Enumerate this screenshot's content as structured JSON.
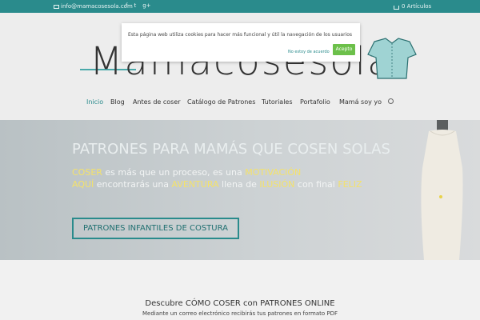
{
  "topbar": {
    "email": "info@mamacosesola.com",
    "social": [
      "f",
      "t",
      "g+"
    ],
    "cart_label": "0 Artículos"
  },
  "logo": {
    "text": "Mamacosesola"
  },
  "nav": {
    "items": [
      "Inicio",
      "Blog",
      "Antes de coser",
      "Catálogo de Patrones",
      "Tutoriales",
      "Portafolio",
      "Mamá soy yo"
    ]
  },
  "cookie": {
    "message": "Esta página web utiliza cookies para hacer más funcional y útil la navegación de los usuarios",
    "decline": "No estoy de acuerdo",
    "accept": "Acepto"
  },
  "hero": {
    "heading": "PATRONES PARA MAMÁS QUE COSEN SOLAS",
    "line1_a": "COSER",
    "line1_b": " es más que un proceso, es una ",
    "line1_c": "MOTIVACIÓN",
    "line2_a": "AQUÍ",
    "line2_b": " encontrarás una ",
    "line2_c": "AVENTURA",
    "line2_d": " llena de ",
    "line2_e": "ILUSIÓN",
    "line2_f": " con final ",
    "line2_g": "FELIZ",
    "cta": "PATRONES INFANTILES DE COSTURA"
  },
  "section": {
    "title": "Descubre CÓMO COSER con PATRONES ONLINE",
    "subtitle": "Mediante un correo electrónico recibirás tus patrones en formato PDF"
  },
  "colors": {
    "accent": "#2a8b8c",
    "accept": "#6cc04a",
    "highlight": "#f4e26a"
  }
}
